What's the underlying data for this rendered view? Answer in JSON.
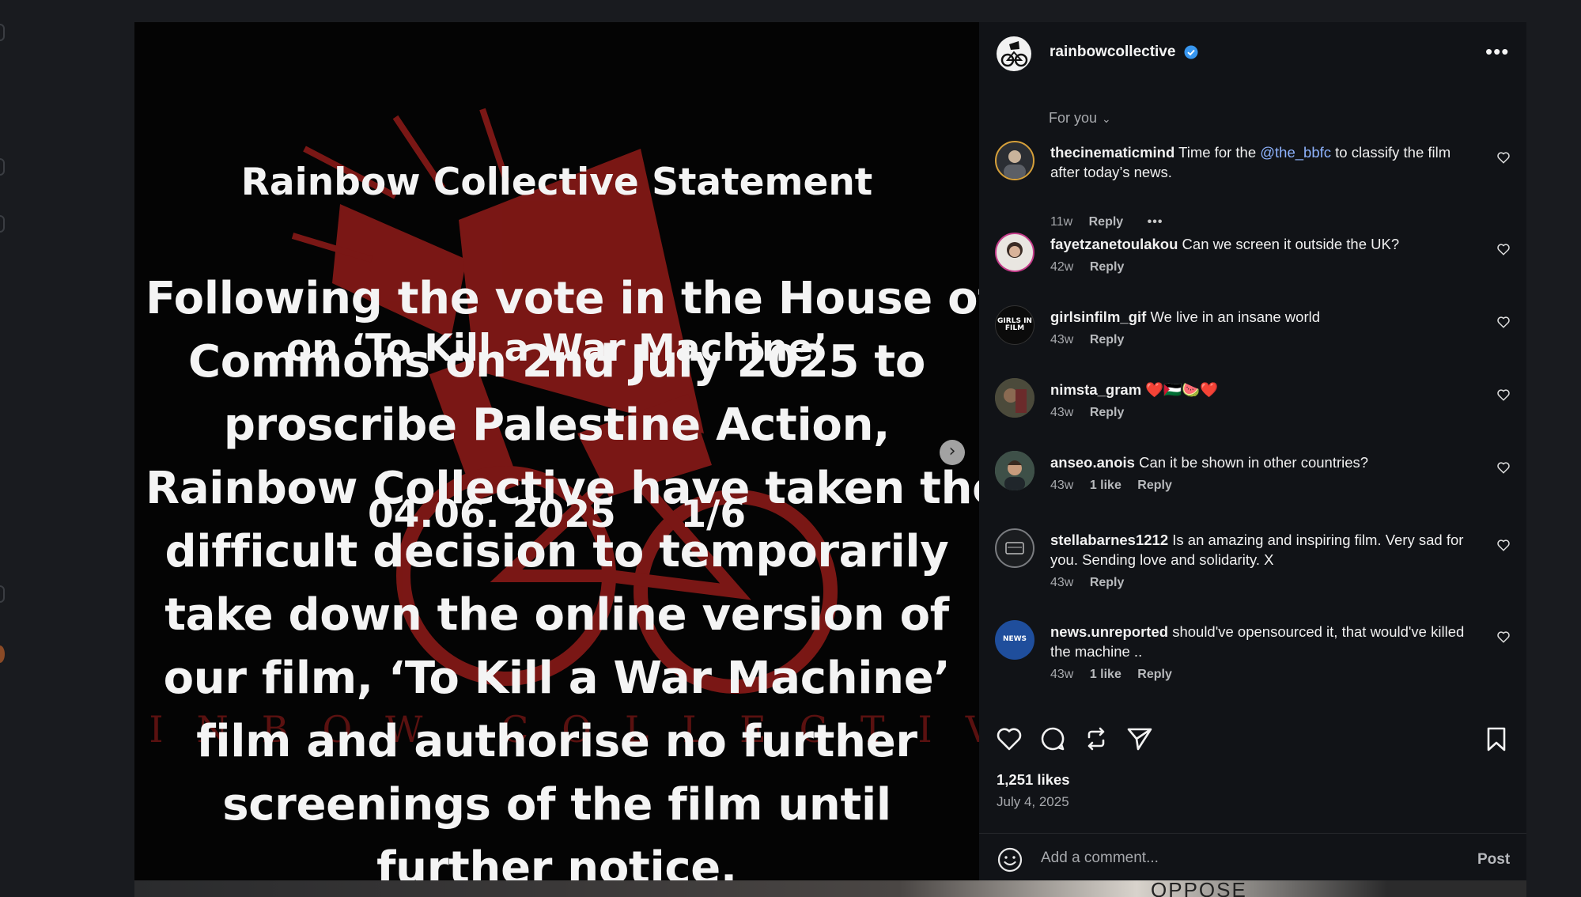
{
  "colors": {
    "background": "#191b1f",
    "panel": "#111317",
    "post_art_red": "#b3201c",
    "mention": "#8fb4ff",
    "verified_blue": "#3897f0"
  },
  "slide": {
    "heading_lines": [
      "Rainbow Collective Statement",
      "on ‘To Kill a War Machine’",
      "04.06. 2025     1/6"
    ],
    "body_lines": [
      "Following the vote in the House of",
      "Commons on 2nd July 2025 to",
      "proscribe Palestine Action,",
      "Rainbow Collective have taken the",
      "difficult decision to temporarily",
      "take down the online version of",
      "our film, ‘To Kill a War Machine’",
      "film and authorise no further",
      "screenings of the film until",
      "further notice."
    ],
    "watermark": "RAINBOW COLLECTIVE",
    "next_icon": "chevron-right-icon"
  },
  "post": {
    "username": "rainbowcollective",
    "verified_icon": "verified-badge-icon",
    "more_icon": "more-horizontal-icon",
    "for_you_label": "For you",
    "comments": [
      {
        "user": "thecinematicmind",
        "pre": "Time for the ",
        "mention": "@the_bbfc",
        "post": " to classify the film after today’s news.",
        "age": "11w",
        "likes": "",
        "reply": "Reply",
        "more": "•••"
      },
      {
        "user": "fayetzanetoulakou",
        "pre": "Can we screen it outside the UK?",
        "mention": "",
        "post": "",
        "age": "42w",
        "likes": "",
        "reply": "Reply",
        "more": ""
      },
      {
        "user": "girlsinfilm_gif",
        "pre": "We live in an insane world",
        "mention": "",
        "post": "",
        "age": "43w",
        "likes": "",
        "reply": "Reply",
        "more": "",
        "avatar_text": "GIRLS IN FILM"
      },
      {
        "user": "nimsta_gram",
        "pre": "❤️🇵🇸🍉❤️",
        "mention": "",
        "post": "",
        "age": "43w",
        "likes": "",
        "reply": "Reply",
        "more": ""
      },
      {
        "user": "anseo.anois",
        "pre": "Can it be shown in other countries?",
        "mention": "",
        "post": "",
        "age": "43w",
        "likes": "1 like",
        "reply": "Reply",
        "more": ""
      },
      {
        "user": "stellabarnes1212",
        "pre": "Is an amazing and inspiring film. Very sad for you. Sending love and solidarity. X",
        "mention": "",
        "post": "",
        "age": "43w",
        "likes": "",
        "reply": "Reply",
        "more": ""
      },
      {
        "user": "news.unreported",
        "pre": "should've opensourced it, that would've killed the machine ..",
        "mention": "",
        "post": "",
        "age": "43w",
        "likes": "1 like",
        "reply": "Reply",
        "more": "",
        "avatar_text": "NEWS"
      }
    ],
    "likes_count": "1,251 likes",
    "date": "July 4, 2025",
    "comment_placeholder": "Add a comment...",
    "post_label": "Post",
    "action_icons": [
      "heart-icon",
      "comment-icon",
      "repost-icon",
      "share-icon",
      "bookmark-icon"
    ]
  },
  "background": {
    "strip_text": "OPPOSE"
  }
}
